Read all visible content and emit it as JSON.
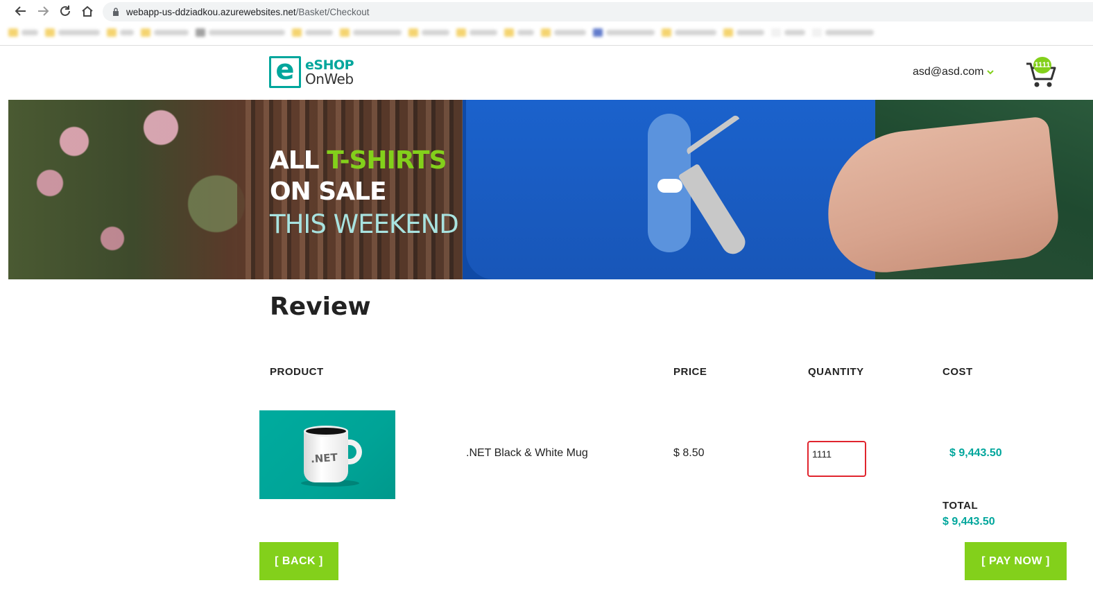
{
  "browser": {
    "url_host": "webapp-us-ddziadkou.azurewebsites.net",
    "url_path": "/Basket/Checkout"
  },
  "header": {
    "logo_letter": "e",
    "logo_line1": "eSHOP",
    "logo_line2": "OnWeb",
    "user_email": "asd@asd.com",
    "cart_count": "1111"
  },
  "hero": {
    "line1_a": "ALL",
    "line1_b": "T-SHIRTS",
    "line2": "ON SALE",
    "line3": "THIS WEEKEND"
  },
  "review": {
    "title": "Review",
    "columns": [
      "PRODUCT",
      "PRICE",
      "QUANTITY",
      "COST"
    ],
    "item": {
      "image_label": ".NET",
      "name": ".NET Black & White Mug",
      "price": "$ 8.50",
      "quantity": "1111",
      "cost": "$ 9,443.50"
    },
    "total_label": "TOTAL",
    "total_value": "$ 9,443.50"
  },
  "actions": {
    "back": "[ BACK ]",
    "pay": "[ PAY NOW ]"
  },
  "colors": {
    "accent_green": "#83d01b",
    "brand_teal": "#00a69c",
    "highlight_red": "#e0242d"
  }
}
